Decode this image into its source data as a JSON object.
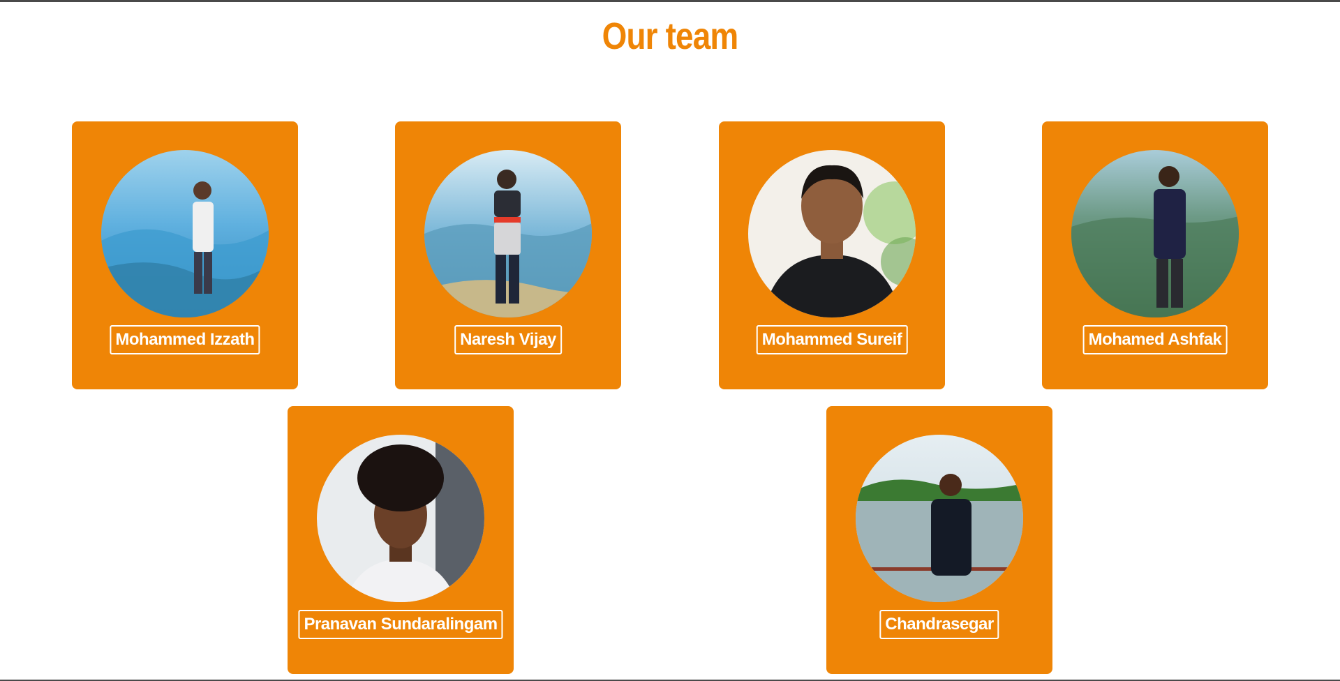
{
  "page": {
    "title": "Our team"
  },
  "team": [
    {
      "name": "Mohammed Izzath",
      "photo": "person-on-mountain-photo"
    },
    {
      "name": "Naresh Vijay",
      "photo": "person-on-hill-photo"
    },
    {
      "name": "Mohammed Sureif",
      "photo": "portrait-photo"
    },
    {
      "name": "Mohamed Ashfak",
      "photo": "person-at-viewpoint-photo"
    },
    {
      "name": "Pranavan Sundaralingam",
      "photo": "selfie-photo"
    },
    {
      "name": "Chandrasegar",
      "photo": "person-at-lake-photo"
    }
  ],
  "colors": {
    "accent": "#ef8506",
    "background": "#ffffff"
  }
}
